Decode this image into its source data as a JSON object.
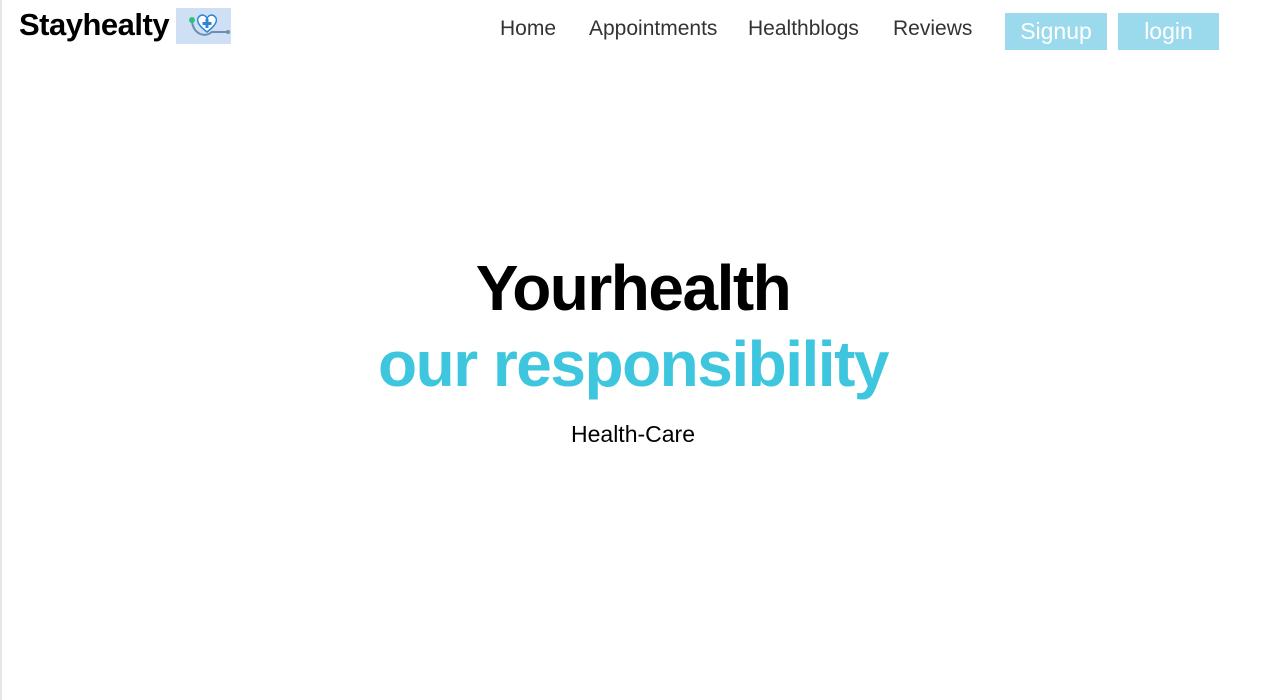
{
  "brand": {
    "name": "Stayhealty",
    "logo_icon": "stethoscope-heart-icon"
  },
  "nav": {
    "links": [
      "Home",
      "Appointments",
      "Healthblogs",
      "Reviews"
    ],
    "signup_label": "Signup",
    "login_label": "login"
  },
  "hero": {
    "line1": "Yourhealth",
    "line2": "our responsibility",
    "subtitle": "Health-Care"
  },
  "colors": {
    "accent": "#3ec6df",
    "button_bg": "#9bdaed",
    "button_text": "#ffffff",
    "text": "#000000"
  }
}
